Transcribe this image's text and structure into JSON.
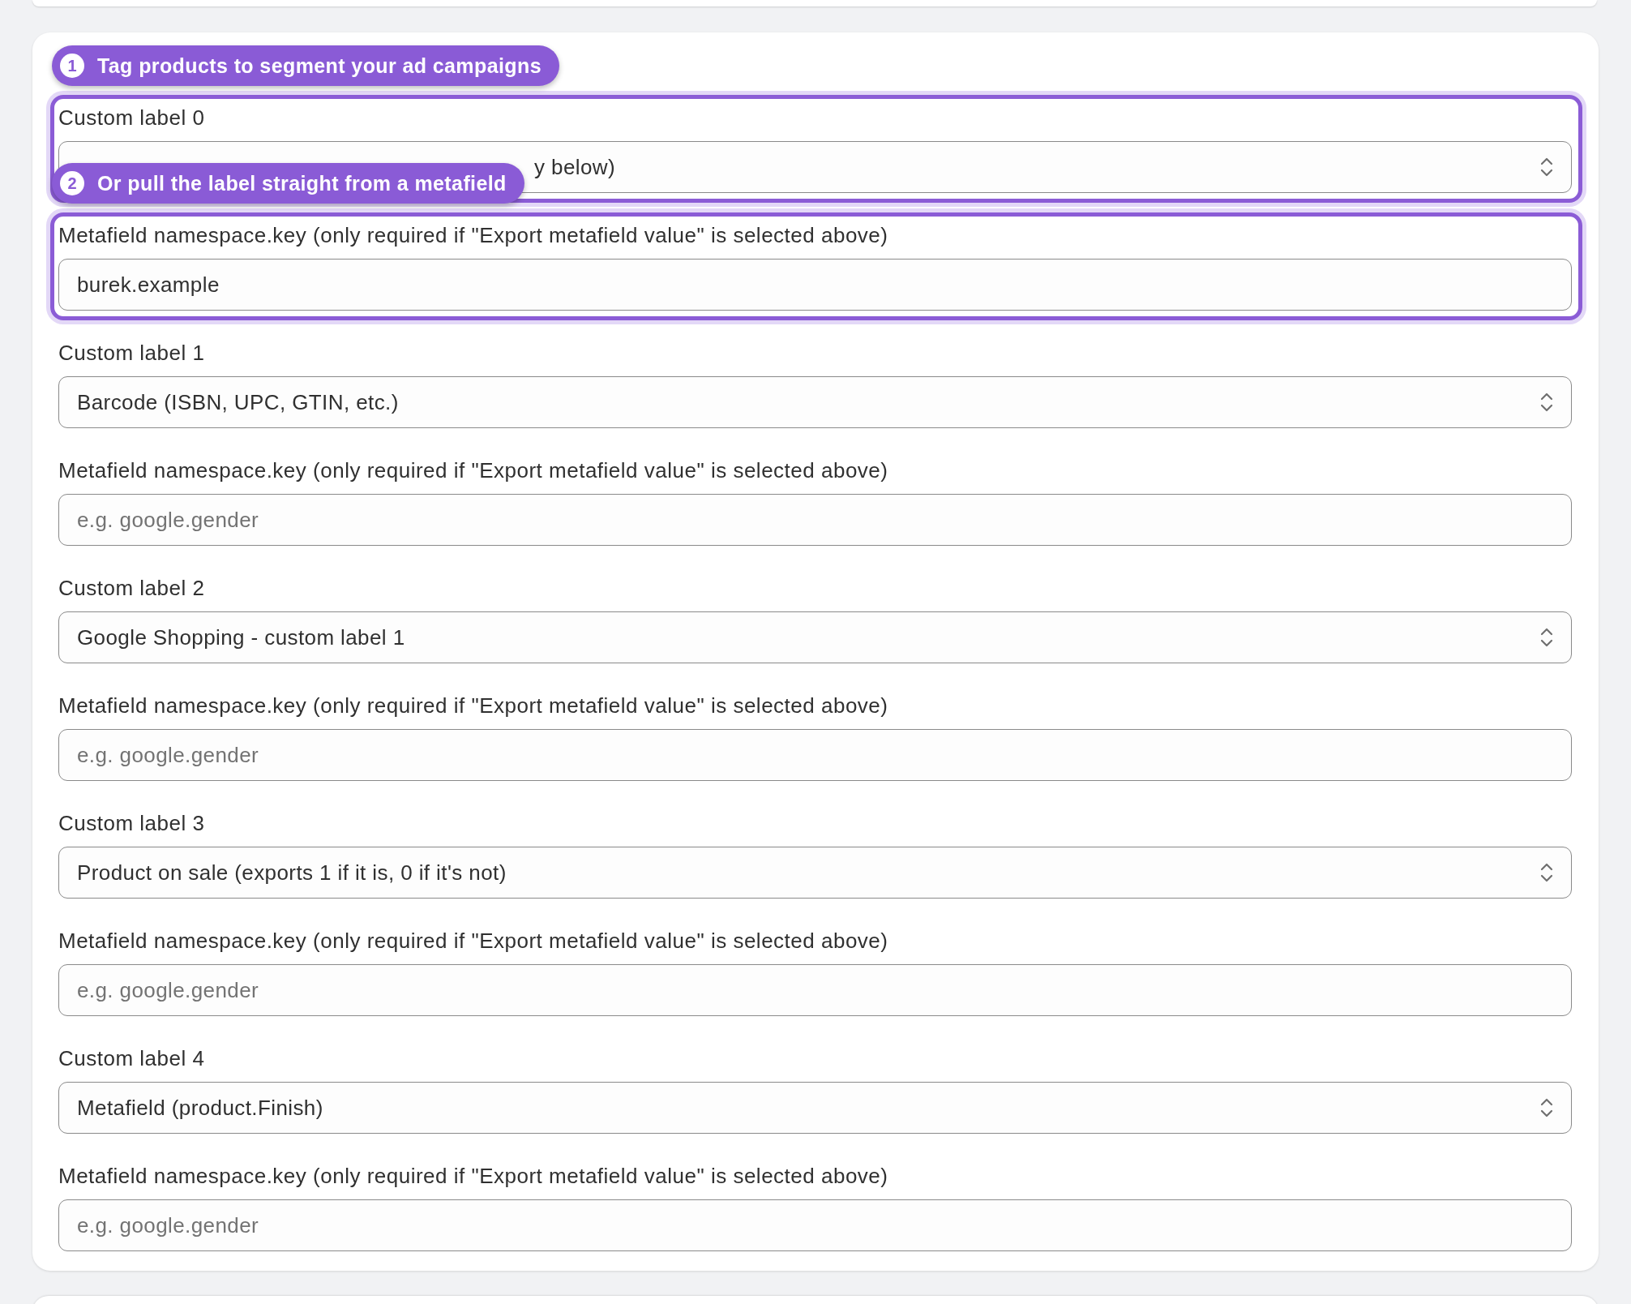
{
  "fields": [
    {
      "label": "Custom label 0",
      "kind": "select",
      "value": "y below)",
      "covered": true,
      "highlighted": true,
      "callout": {
        "number": "1",
        "text": "Tag products to segment your ad campaigns"
      }
    },
    {
      "label": "Metafield namespace.key (only required if \"Export metafield value\" is selected above)",
      "kind": "text",
      "value": "burek.example",
      "highlighted": true,
      "callout": {
        "number": "2",
        "text": "Or pull the label straight from a metafield"
      }
    },
    {
      "label": "Custom label 1",
      "kind": "select",
      "value": "Barcode (ISBN, UPC, GTIN, etc.)",
      "highlighted": false
    },
    {
      "label": "Metafield namespace.key (only required if \"Export metafield value\" is selected above)",
      "kind": "text",
      "placeholder": "e.g. google.gender",
      "highlighted": false
    },
    {
      "label": "Custom label 2",
      "kind": "select",
      "value": "Google Shopping - custom label 1",
      "highlighted": false
    },
    {
      "label": "Metafield namespace.key (only required if \"Export metafield value\" is selected above)",
      "kind": "text",
      "placeholder": "e.g. google.gender",
      "highlighted": false
    },
    {
      "label": "Custom label 3",
      "kind": "select",
      "value": "Product on sale (exports 1 if it is, 0 if it's not)",
      "highlighted": false
    },
    {
      "label": "Metafield namespace.key (only required if \"Export metafield value\" is selected above)",
      "kind": "text",
      "placeholder": "e.g. google.gender",
      "highlighted": false
    },
    {
      "label": "Custom label 4",
      "kind": "select",
      "value": "Metafield (product.Finish)",
      "highlighted": false
    },
    {
      "label": "Metafield namespace.key (only required if \"Export metafield value\" is selected above)",
      "kind": "text",
      "placeholder": "e.g. google.gender",
      "highlighted": false
    }
  ]
}
